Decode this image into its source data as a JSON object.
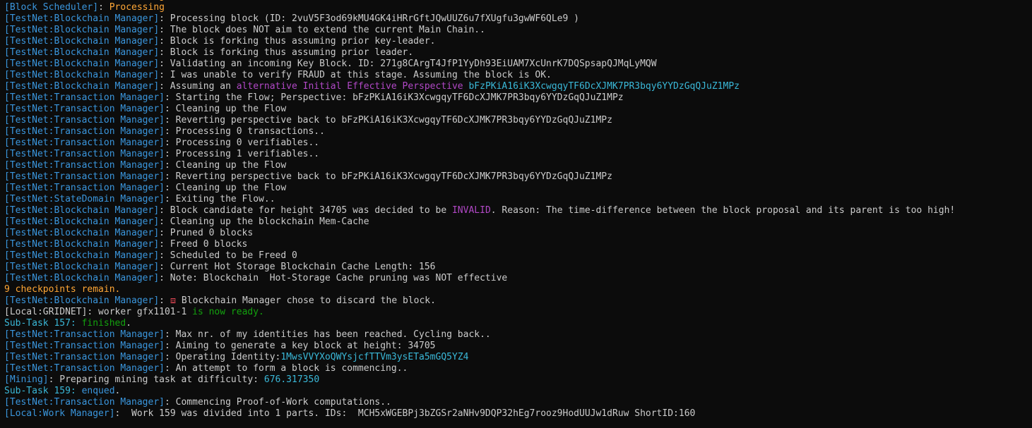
{
  "window": {
    "background": "#0c0c0c"
  },
  "colors": {
    "default": "#cccccc",
    "tag_blue": "#3a96dd",
    "orange": "#ffa736",
    "magenta": "#b148c6",
    "cyan": "#3ab8d8",
    "green": "#13a10e",
    "red_icon": "#e74856"
  },
  "lines": [
    [
      {
        "t": "[Block Scheduler]",
        "c": "blue"
      },
      {
        "t": ": ",
        "c": "gray"
      },
      {
        "t": "Processing",
        "c": "orange"
      }
    ],
    [
      {
        "t": "[Block Scheduler]",
        "c": "blue"
      },
      {
        "t": ": ",
        "c": "gray"
      },
      {
        "t": "Processing",
        "c": "orange"
      }
    ],
    [
      {
        "t": "[TestNet:Blockchain Manager]",
        "c": "blue"
      },
      {
        "t": ": Processing block (ID: 2vuV5F3od69kMU4GK4iHRrGftJQwUUZ6u7fXUgfu3gwWF6QLe9 )",
        "c": "gray"
      }
    ],
    [
      {
        "t": "[TestNet:Blockchain Manager]",
        "c": "blue"
      },
      {
        "t": ": The block does NOT aim to extend the current Main Chain..",
        "c": "gray"
      }
    ],
    [
      {
        "t": "[TestNet:Blockchain Manager]",
        "c": "blue"
      },
      {
        "t": ": Block is forking thus assuming prior key-leader.",
        "c": "gray"
      }
    ],
    [
      {
        "t": "[TestNet:Blockchain Manager]",
        "c": "blue"
      },
      {
        "t": ": Block is forking thus assuming prior leader.",
        "c": "gray"
      }
    ],
    [
      {
        "t": "[TestNet:Blockchain Manager]",
        "c": "blue"
      },
      {
        "t": ": Validating an incoming Key Block. ID: 271g8CArgT4JfP1YyDh93EiUAM7XcUnrK7DQSpsapQJMqLyMQW",
        "c": "gray"
      }
    ],
    [
      {
        "t": "[TestNet:Blockchain Manager]",
        "c": "blue"
      },
      {
        "t": ": I was unable to verify FRAUD at this stage. Assuming the block is OK.",
        "c": "gray"
      }
    ],
    [
      {
        "t": "[TestNet:Blockchain Manager]",
        "c": "blue"
      },
      {
        "t": ": Assuming an ",
        "c": "gray"
      },
      {
        "t": "alternative Initial Effective Perspective",
        "c": "magenta"
      },
      {
        "t": " bFzPKiA16iK3XcwgqyTF6DcXJMK7PR3bqy6YYDzGqQJuZ1MPz",
        "c": "cyan"
      }
    ],
    [
      {
        "t": "[TestNet:Transaction Manager]",
        "c": "blue"
      },
      {
        "t": ": Starting the Flow; Perspective: bFzPKiA16iK3XcwgqyTF6DcXJMK7PR3bqy6YYDzGqQJuZ1MPz",
        "c": "gray"
      }
    ],
    [
      {
        "t": "[TestNet:Transaction Manager]",
        "c": "blue"
      },
      {
        "t": ": Cleaning up the Flow",
        "c": "gray"
      }
    ],
    [
      {
        "t": "[TestNet:Transaction Manager]",
        "c": "blue"
      },
      {
        "t": ": Reverting perspective back to bFzPKiA16iK3XcwgqyTF6DcXJMK7PR3bqy6YYDzGqQJuZ1MPz",
        "c": "gray"
      }
    ],
    [
      {
        "t": "[TestNet:Transaction Manager]",
        "c": "blue"
      },
      {
        "t": ": Processing 0 transactions..",
        "c": "gray"
      }
    ],
    [
      {
        "t": "[TestNet:Transaction Manager]",
        "c": "blue"
      },
      {
        "t": ": Processing 0 verifiables..",
        "c": "gray"
      }
    ],
    [
      {
        "t": "[TestNet:Transaction Manager]",
        "c": "blue"
      },
      {
        "t": ": Processing 1 verifiables..",
        "c": "gray"
      }
    ],
    [
      {
        "t": "[TestNet:Transaction Manager]",
        "c": "blue"
      },
      {
        "t": ": Cleaning up the Flow",
        "c": "gray"
      }
    ],
    [
      {
        "t": "[TestNet:Transaction Manager]",
        "c": "blue"
      },
      {
        "t": ": Reverting perspective back to bFzPKiA16iK3XcwgqyTF6DcXJMK7PR3bqy6YYDzGqQJuZ1MPz",
        "c": "gray"
      }
    ],
    [
      {
        "t": "[TestNet:Transaction Manager]",
        "c": "blue"
      },
      {
        "t": ": Cleaning up the Flow",
        "c": "gray"
      }
    ],
    [
      {
        "t": "[TestNet:StateDomain Manager]",
        "c": "blue"
      },
      {
        "t": ": Exiting the Flow..",
        "c": "gray"
      }
    ],
    [
      {
        "t": "[TestNet:Blockchain Manager]",
        "c": "blue"
      },
      {
        "t": ": Block candidate for height 34705 was decided to be ",
        "c": "gray"
      },
      {
        "t": "INVALID",
        "c": "magenta"
      },
      {
        "t": ". Reason: The time-difference between the block proposal and its parent is too high!",
        "c": "gray"
      }
    ],
    [
      {
        "t": "[TestNet:Blockchain Manager]",
        "c": "blue"
      },
      {
        "t": ": Cleaning up the blockchain Mem-Cache",
        "c": "gray"
      }
    ],
    [
      {
        "t": "[TestNet:Blockchain Manager]",
        "c": "blue"
      },
      {
        "t": ": Pruned 0 blocks",
        "c": "gray"
      }
    ],
    [
      {
        "t": "[TestNet:Blockchain Manager]",
        "c": "blue"
      },
      {
        "t": ": Freed 0 blocks",
        "c": "gray"
      }
    ],
    [
      {
        "t": "[TestNet:Blockchain Manager]",
        "c": "blue"
      },
      {
        "t": ": Scheduled to be Freed 0",
        "c": "gray"
      }
    ],
    [
      {
        "t": "[TestNet:Blockchain Manager]",
        "c": "blue"
      },
      {
        "t": ": Current Hot Storage Blockchain Cache Length: 156",
        "c": "gray"
      }
    ],
    [
      {
        "t": "[TestNet:Blockchain Manager]",
        "c": "blue"
      },
      {
        "t": ": Note: Blockchain  Hot-Storage Cache pruning was NOT effective",
        "c": "gray"
      }
    ],
    [
      {
        "t": "9 checkpoints remain.",
        "c": "orange"
      }
    ],
    [
      {
        "t": "[TestNet:Blockchain Manager]",
        "c": "blue"
      },
      {
        "t": ": ",
        "c": "gray"
      },
      {
        "t": "⧈",
        "c": "red"
      },
      {
        "t": " Blockchain Manager chose to discard the block.",
        "c": "gray"
      }
    ],
    [
      {
        "t": "[Local:GRIDNET]",
        "c": "gray"
      },
      {
        "t": ": worker gfx1101-1 ",
        "c": "gray"
      },
      {
        "t": "is now ready.",
        "c": "green"
      }
    ],
    [
      {
        "t": "Sub-Task 157: ",
        "c": "cyan"
      },
      {
        "t": "finished",
        "c": "green"
      },
      {
        "t": ".",
        "c": "gray"
      }
    ],
    [
      {
        "t": "[TestNet:Transaction Manager]",
        "c": "blue"
      },
      {
        "t": ": Max nr. of my identities has been reached. Cycling back..",
        "c": "gray"
      }
    ],
    [
      {
        "t": "[TestNet:Transaction Manager]",
        "c": "blue"
      },
      {
        "t": ": Aiming to generate a key block at height: 34705",
        "c": "gray"
      }
    ],
    [
      {
        "t": "[TestNet:Transaction Manager]",
        "c": "blue"
      },
      {
        "t": ": Operating Identity:",
        "c": "gray"
      },
      {
        "t": "1MwsVVYXoQWYsjcfTTVm3ysETa5mGQ5YZ4",
        "c": "cyan"
      }
    ],
    [
      {
        "t": "[TestNet:Transaction Manager]",
        "c": "blue"
      },
      {
        "t": ": An attempt to form a block is commencing..",
        "c": "gray"
      }
    ],
    [
      {
        "t": "[Mining]",
        "c": "blue"
      },
      {
        "t": ": Preparing mining task at difficulty: ",
        "c": "gray"
      },
      {
        "t": "676.317350",
        "c": "cyan"
      }
    ],
    [
      {
        "t": "Sub-Task 159: ",
        "c": "cyan"
      },
      {
        "t": "enqued",
        "c": "blue"
      },
      {
        "t": ".",
        "c": "gray"
      }
    ],
    [
      {
        "t": "[TestNet:Transaction Manager]",
        "c": "blue"
      },
      {
        "t": ": Commencing Proof-of-Work computations..",
        "c": "gray"
      }
    ],
    [
      {
        "t": "[Local:Work Manager]",
        "c": "blue"
      },
      {
        "t": ":  Work 159 was divided into 1 parts. IDs:  MCH5xWGEBPj3bZGSr2aNHv9DQP32hEg7rooz9HodUUJw1dRuw ShortID:160",
        "c": "gray"
      }
    ]
  ]
}
